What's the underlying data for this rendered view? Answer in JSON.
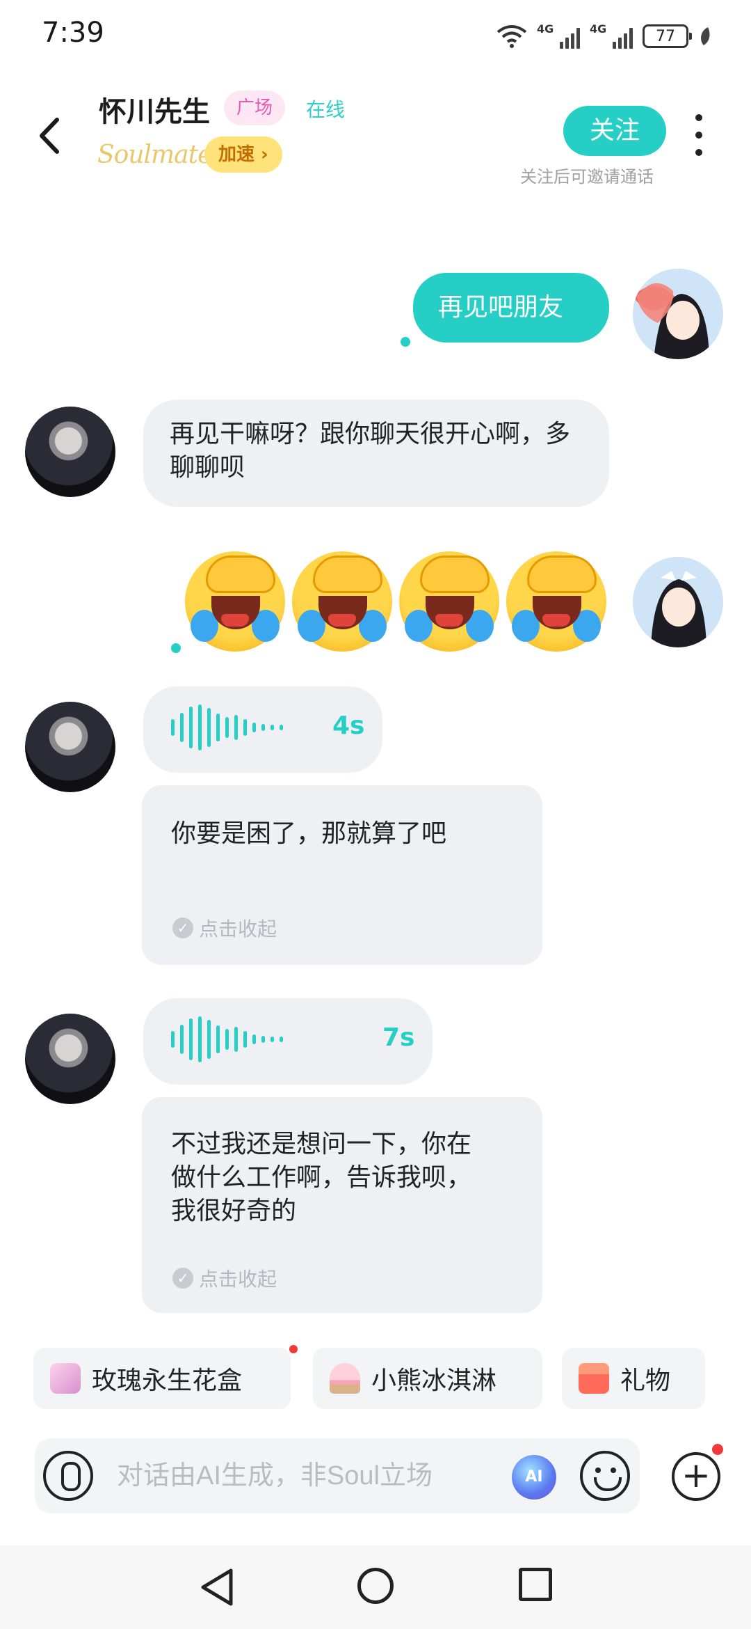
{
  "status_bar": {
    "time": "7:39",
    "battery": "77",
    "network_1": "4G",
    "network_2": "4G"
  },
  "header": {
    "name": "怀川先生",
    "plaza_tag": "广场",
    "online": "在线",
    "soulmate": "Soulmate",
    "boost": "加速 ›",
    "follow": "关注",
    "follow_hint": "关注后可邀请通话"
  },
  "messages": [
    {
      "side": "right",
      "type": "text",
      "text": "再见吧朋友"
    },
    {
      "side": "left",
      "type": "text",
      "text": "再见干嘛呀？跟你聊天很开心啊，多聊聊呗"
    },
    {
      "side": "right",
      "type": "emoji",
      "emoji": "face-with-hand-crying-emoji",
      "count": 4
    },
    {
      "side": "left",
      "type": "voice",
      "duration": "4s",
      "transcript": "你要是困了，那就算了吧",
      "collapse": "点击收起"
    },
    {
      "side": "left",
      "type": "voice",
      "duration": "7s",
      "transcript": "不过我还是想问一下，你在做什么工作啊，告诉我呗，我很好奇的",
      "collapse": "点击收起"
    }
  ],
  "suggestions": [
    {
      "label": "玫瑰永生花盒",
      "icon": "rose-box-icon"
    },
    {
      "label": "小熊冰淇淋",
      "icon": "ice-cream-icon"
    },
    {
      "label": "礼物",
      "icon": "gift-icon"
    }
  ],
  "input": {
    "placeholder": "对话由AI生成，非Soul立场",
    "ai_label": "AI"
  },
  "colors": {
    "accent": "#26cfc6",
    "bubble_in": "#eef0f3",
    "badge_dot": "#f03a3a"
  }
}
